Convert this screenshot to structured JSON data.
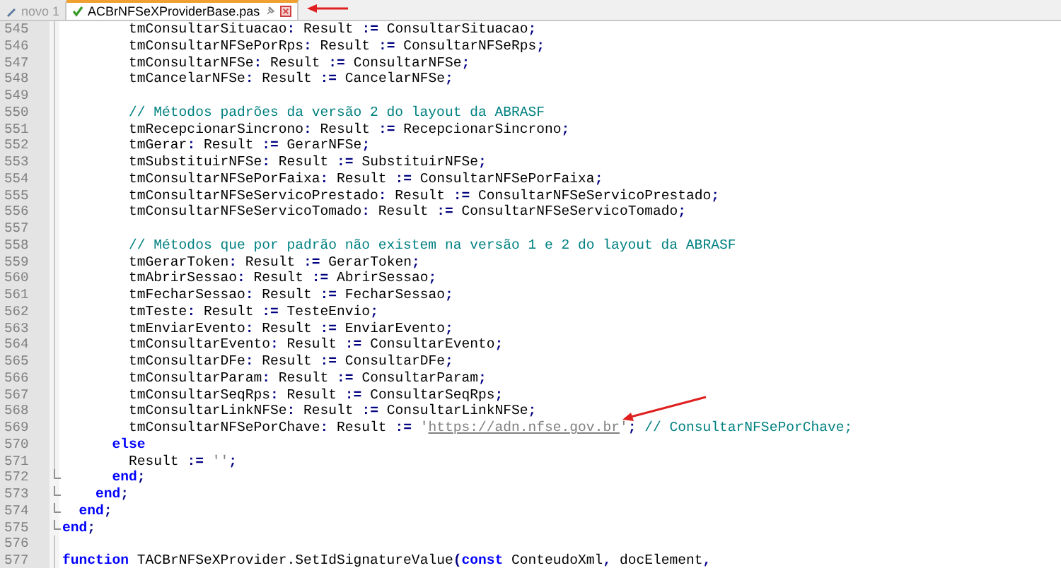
{
  "tabs": [
    {
      "label": "novo 1",
      "selected": false,
      "kind": "new"
    },
    {
      "label": "ACBrNFSeXProviderBase.pas",
      "selected": true,
      "kind": "saved"
    }
  ],
  "lines": [
    {
      "no": "545",
      "fold_end": false,
      "tokens": [
        {
          "text": "        tmConsultarSituacao",
          "kind": "plain"
        },
        {
          "text": ":",
          "kind": "operator"
        },
        {
          "text": " Result ",
          "kind": "plain"
        },
        {
          "text": ":=",
          "kind": "operator"
        },
        {
          "text": " ConsultarSituacao",
          "kind": "plain"
        },
        {
          "text": ";",
          "kind": "operator"
        }
      ]
    },
    {
      "no": "546",
      "fold_end": false,
      "tokens": [
        {
          "text": "        tmConsultarNFSePorRps",
          "kind": "plain"
        },
        {
          "text": ":",
          "kind": "operator"
        },
        {
          "text": " Result ",
          "kind": "plain"
        },
        {
          "text": ":=",
          "kind": "operator"
        },
        {
          "text": " ConsultarNFSeRps",
          "kind": "plain"
        },
        {
          "text": ";",
          "kind": "operator"
        }
      ]
    },
    {
      "no": "547",
      "fold_end": false,
      "tokens": [
        {
          "text": "        tmConsultarNFSe",
          "kind": "plain"
        },
        {
          "text": ":",
          "kind": "operator"
        },
        {
          "text": " Result ",
          "kind": "plain"
        },
        {
          "text": ":=",
          "kind": "operator"
        },
        {
          "text": " ConsultarNFSe",
          "kind": "plain"
        },
        {
          "text": ";",
          "kind": "operator"
        }
      ]
    },
    {
      "no": "548",
      "fold_end": false,
      "tokens": [
        {
          "text": "        tmCancelarNFSe",
          "kind": "plain"
        },
        {
          "text": ":",
          "kind": "operator"
        },
        {
          "text": " Result ",
          "kind": "plain"
        },
        {
          "text": ":=",
          "kind": "operator"
        },
        {
          "text": " CancelarNFSe",
          "kind": "plain"
        },
        {
          "text": ";",
          "kind": "operator"
        }
      ]
    },
    {
      "no": "549",
      "fold_end": false
    },
    {
      "no": "550",
      "fold_end": false,
      "tokens": [
        {
          "text": "        // Métodos padrões da versão 2 do layout da ABRASF",
          "kind": "comment"
        }
      ]
    },
    {
      "no": "551",
      "fold_end": false,
      "tokens": [
        {
          "text": "        tmRecepcionarSincrono",
          "kind": "plain"
        },
        {
          "text": ":",
          "kind": "operator"
        },
        {
          "text": " Result ",
          "kind": "plain"
        },
        {
          "text": ":=",
          "kind": "operator"
        },
        {
          "text": " RecepcionarSincrono",
          "kind": "plain"
        },
        {
          "text": ";",
          "kind": "operator"
        }
      ]
    },
    {
      "no": "552",
      "fold_end": false,
      "tokens": [
        {
          "text": "        tmGerar",
          "kind": "plain"
        },
        {
          "text": ":",
          "kind": "operator"
        },
        {
          "text": " Result ",
          "kind": "plain"
        },
        {
          "text": ":=",
          "kind": "operator"
        },
        {
          "text": " GerarNFSe",
          "kind": "plain"
        },
        {
          "text": ";",
          "kind": "operator"
        }
      ]
    },
    {
      "no": "553",
      "fold_end": false,
      "tokens": [
        {
          "text": "        tmSubstituirNFSe",
          "kind": "plain"
        },
        {
          "text": ":",
          "kind": "operator"
        },
        {
          "text": " Result ",
          "kind": "plain"
        },
        {
          "text": ":=",
          "kind": "operator"
        },
        {
          "text": " SubstituirNFSe",
          "kind": "plain"
        },
        {
          "text": ";",
          "kind": "operator"
        }
      ]
    },
    {
      "no": "554",
      "fold_end": false,
      "tokens": [
        {
          "text": "        tmConsultarNFSePorFaixa",
          "kind": "plain"
        },
        {
          "text": ":",
          "kind": "operator"
        },
        {
          "text": " Result ",
          "kind": "plain"
        },
        {
          "text": ":=",
          "kind": "operator"
        },
        {
          "text": " ConsultarNFSePorFaixa",
          "kind": "plain"
        },
        {
          "text": ";",
          "kind": "operator"
        }
      ]
    },
    {
      "no": "555",
      "fold_end": false,
      "tokens": [
        {
          "text": "        tmConsultarNFSeServicoPrestado",
          "kind": "plain"
        },
        {
          "text": ":",
          "kind": "operator"
        },
        {
          "text": " Result ",
          "kind": "plain"
        },
        {
          "text": ":=",
          "kind": "operator"
        },
        {
          "text": " ConsultarNFSeServicoPrestado",
          "kind": "plain"
        },
        {
          "text": ";",
          "kind": "operator"
        }
      ]
    },
    {
      "no": "556",
      "fold_end": false,
      "tokens": [
        {
          "text": "        tmConsultarNFSeServicoTomado",
          "kind": "plain"
        },
        {
          "text": ":",
          "kind": "operator"
        },
        {
          "text": " Result ",
          "kind": "plain"
        },
        {
          "text": ":=",
          "kind": "operator"
        },
        {
          "text": " ConsultarNFSeServicoTomado",
          "kind": "plain"
        },
        {
          "text": ";",
          "kind": "operator"
        }
      ]
    },
    {
      "no": "557",
      "fold_end": false
    },
    {
      "no": "558",
      "fold_end": false,
      "tokens": [
        {
          "text": "        // Métodos que por padrão não existem na versão 1 e 2 do layout da ABRASF",
          "kind": "comment"
        }
      ]
    },
    {
      "no": "559",
      "fold_end": false,
      "tokens": [
        {
          "text": "        tmGerarToken",
          "kind": "plain"
        },
        {
          "text": ":",
          "kind": "operator"
        },
        {
          "text": " Result ",
          "kind": "plain"
        },
        {
          "text": ":=",
          "kind": "operator"
        },
        {
          "text": " GerarToken",
          "kind": "plain"
        },
        {
          "text": ";",
          "kind": "operator"
        }
      ]
    },
    {
      "no": "560",
      "fold_end": false,
      "tokens": [
        {
          "text": "        tmAbrirSessao",
          "kind": "plain"
        },
        {
          "text": ":",
          "kind": "operator"
        },
        {
          "text": " Result ",
          "kind": "plain"
        },
        {
          "text": ":=",
          "kind": "operator"
        },
        {
          "text": " AbrirSessao",
          "kind": "plain"
        },
        {
          "text": ";",
          "kind": "operator"
        }
      ]
    },
    {
      "no": "561",
      "fold_end": false,
      "tokens": [
        {
          "text": "        tmFecharSessao",
          "kind": "plain"
        },
        {
          "text": ":",
          "kind": "operator"
        },
        {
          "text": " Result ",
          "kind": "plain"
        },
        {
          "text": ":=",
          "kind": "operator"
        },
        {
          "text": " FecharSessao",
          "kind": "plain"
        },
        {
          "text": ";",
          "kind": "operator"
        }
      ]
    },
    {
      "no": "562",
      "fold_end": false,
      "tokens": [
        {
          "text": "        tmTeste",
          "kind": "plain"
        },
        {
          "text": ":",
          "kind": "operator"
        },
        {
          "text": " Result ",
          "kind": "plain"
        },
        {
          "text": ":=",
          "kind": "operator"
        },
        {
          "text": " TesteEnvio",
          "kind": "plain"
        },
        {
          "text": ";",
          "kind": "operator"
        }
      ]
    },
    {
      "no": "563",
      "fold_end": false,
      "tokens": [
        {
          "text": "        tmEnviarEvento",
          "kind": "plain"
        },
        {
          "text": ":",
          "kind": "operator"
        },
        {
          "text": " Result ",
          "kind": "plain"
        },
        {
          "text": ":=",
          "kind": "operator"
        },
        {
          "text": " EnviarEvento",
          "kind": "plain"
        },
        {
          "text": ";",
          "kind": "operator"
        }
      ]
    },
    {
      "no": "564",
      "fold_end": false,
      "tokens": [
        {
          "text": "        tmConsultarEvento",
          "kind": "plain"
        },
        {
          "text": ":",
          "kind": "operator"
        },
        {
          "text": " Result ",
          "kind": "plain"
        },
        {
          "text": ":=",
          "kind": "operator"
        },
        {
          "text": " ConsultarEvento",
          "kind": "plain"
        },
        {
          "text": ";",
          "kind": "operator"
        }
      ]
    },
    {
      "no": "565",
      "fold_end": false,
      "tokens": [
        {
          "text": "        tmConsultarDFe",
          "kind": "plain"
        },
        {
          "text": ":",
          "kind": "operator"
        },
        {
          "text": " Result ",
          "kind": "plain"
        },
        {
          "text": ":=",
          "kind": "operator"
        },
        {
          "text": " ConsultarDFe",
          "kind": "plain"
        },
        {
          "text": ";",
          "kind": "operator"
        }
      ]
    },
    {
      "no": "566",
      "fold_end": false,
      "tokens": [
        {
          "text": "        tmConsultarParam",
          "kind": "plain"
        },
        {
          "text": ":",
          "kind": "operator"
        },
        {
          "text": " Result ",
          "kind": "plain"
        },
        {
          "text": ":=",
          "kind": "operator"
        },
        {
          "text": " ConsultarParam",
          "kind": "plain"
        },
        {
          "text": ";",
          "kind": "operator"
        }
      ]
    },
    {
      "no": "567",
      "fold_end": false,
      "tokens": [
        {
          "text": "        tmConsultarSeqRps",
          "kind": "plain"
        },
        {
          "text": ":",
          "kind": "operator"
        },
        {
          "text": " Result ",
          "kind": "plain"
        },
        {
          "text": ":=",
          "kind": "operator"
        },
        {
          "text": " ConsultarSeqRps",
          "kind": "plain"
        },
        {
          "text": ";",
          "kind": "operator"
        }
      ]
    },
    {
      "no": "568",
      "fold_end": false,
      "tokens": [
        {
          "text": "        tmConsultarLinkNFSe",
          "kind": "plain"
        },
        {
          "text": ":",
          "kind": "operator"
        },
        {
          "text": " Result ",
          "kind": "plain"
        },
        {
          "text": ":=",
          "kind": "operator"
        },
        {
          "text": " ConsultarLinkNFSe",
          "kind": "plain"
        },
        {
          "text": ";",
          "kind": "operator"
        }
      ]
    },
    {
      "no": "569",
      "fold_end": false,
      "tokens": [
        {
          "text": "        tmConsultarNFSePorChave",
          "kind": "plain"
        },
        {
          "text": ":",
          "kind": "operator"
        },
        {
          "text": " Result ",
          "kind": "plain"
        },
        {
          "text": ":=",
          "kind": "operator"
        },
        {
          "text": " '",
          "kind": "string"
        },
        {
          "text": "https://adn.nfse.gov.br",
          "kind": "link"
        },
        {
          "text": "'",
          "kind": "string"
        },
        {
          "text": ";",
          "kind": "operator"
        },
        {
          "text": " // ConsultarNFSePorChave;",
          "kind": "comment"
        }
      ]
    },
    {
      "no": "570",
      "fold_end": false,
      "tokens": [
        {
          "text": "      else",
          "kind": "keyword"
        }
      ]
    },
    {
      "no": "571",
      "fold_end": false,
      "tokens": [
        {
          "text": "        Result ",
          "kind": "plain"
        },
        {
          "text": ":=",
          "kind": "operator"
        },
        {
          "text": " ''",
          "kind": "string"
        },
        {
          "text": ";",
          "kind": "operator"
        }
      ]
    },
    {
      "no": "572",
      "fold_end": true,
      "tokens": [
        {
          "text": "      end",
          "kind": "keyword"
        },
        {
          "text": ";",
          "kind": "operator"
        }
      ]
    },
    {
      "no": "573",
      "fold_end": true,
      "tokens": [
        {
          "text": "    end",
          "kind": "keyword"
        },
        {
          "text": ";",
          "kind": "operator"
        }
      ]
    },
    {
      "no": "574",
      "fold_end": true,
      "tokens": [
        {
          "text": "  end",
          "kind": "keyword"
        },
        {
          "text": ";",
          "kind": "operator"
        }
      ]
    },
    {
      "no": "575",
      "fold_end": true,
      "tokens": [
        {
          "text": "end",
          "kind": "keyword"
        },
        {
          "text": ";",
          "kind": "operator"
        }
      ]
    },
    {
      "no": "576",
      "fold_end": false
    },
    {
      "no": "577",
      "fold_end": false,
      "tokens": [
        {
          "text": "function",
          "kind": "keyword"
        },
        {
          "text": " TACBrNFSeXProvider.SetIdSignatureValue",
          "kind": "plain"
        },
        {
          "text": "(",
          "kind": "operator"
        },
        {
          "text": "const",
          "kind": "keyword"
        },
        {
          "text": " ConteudoXml",
          "kind": "plain"
        },
        {
          "text": ",",
          "kind": "operator"
        },
        {
          "text": " docElement",
          "kind": "plain"
        },
        {
          "text": ",",
          "kind": "operator"
        }
      ]
    }
  ]
}
